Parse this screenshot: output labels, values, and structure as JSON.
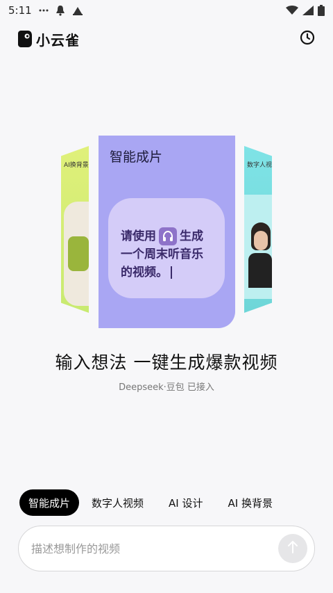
{
  "status_bar": {
    "time": "5:11",
    "icons": [
      "more-dots-icon",
      "notification-bell-icon",
      "app-notification-icon",
      "wifi-icon",
      "signal-icon",
      "battery-icon"
    ]
  },
  "header": {
    "app_title": "小云雀",
    "logo_icon": "bird-logo-icon",
    "history_icon": "clock-icon"
  },
  "carousel": {
    "left_card_label": "AI换背景",
    "main_card": {
      "title": "智能成片",
      "prompt_line1_prefix": "请使用",
      "prompt_line1_suffix": "生成",
      "prompt_line2": "一个周末听音乐",
      "prompt_line3": "的视频。",
      "inline_icon": "headphones-icon"
    },
    "right_card_label": "数字人视频"
  },
  "headline": "输入想法 一键生成爆款视频",
  "subline": "Deepseek·豆包 已接入",
  "tabs": [
    {
      "label": "智能成片",
      "active": true
    },
    {
      "label": "数字人视频",
      "active": false
    },
    {
      "label": "AI 设计",
      "active": false
    },
    {
      "label": "AI 换背景",
      "active": false
    }
  ],
  "input": {
    "placeholder": "描述想制作的视频",
    "value": "",
    "send_icon": "arrow-up-icon"
  },
  "colors": {
    "main_card": "#a9a6f3",
    "bubble": "#d4ccf8",
    "active_tab_bg": "#000000",
    "left_card": "#d8ee74",
    "right_card": "#7fe3e6"
  }
}
